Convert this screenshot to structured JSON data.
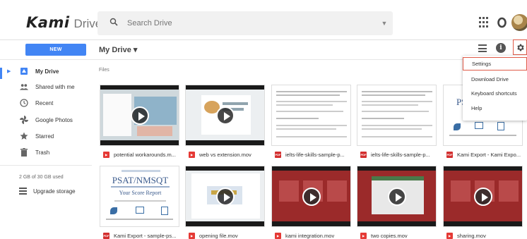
{
  "app": {
    "logo_main": "Kami",
    "logo_sub": "Drive"
  },
  "search": {
    "placeholder": "Search Drive"
  },
  "toolbar": {
    "new_label": "NEW",
    "title": "My Drive ▾"
  },
  "sidebar": {
    "items": [
      {
        "label": "My Drive",
        "icon": "my-drive-icon"
      },
      {
        "label": "Shared with me",
        "icon": "people-icon"
      },
      {
        "label": "Recent",
        "icon": "clock-icon"
      },
      {
        "label": "Google Photos",
        "icon": "pinwheel-icon"
      },
      {
        "label": "Starred",
        "icon": "star-icon"
      },
      {
        "label": "Trash",
        "icon": "trash-icon"
      }
    ],
    "storage": "2 GB of 30 GB used",
    "upgrade": "Upgrade storage"
  },
  "files": {
    "section_label": "Files",
    "items": [
      {
        "name": "potential workarounds.m...",
        "type": "mov"
      },
      {
        "name": "web vs extension.mov",
        "type": "mov"
      },
      {
        "name": "ielts-life-skills-sample-p...",
        "type": "pdf"
      },
      {
        "name": "ielts-life-skills-sample-p...",
        "type": "pdf"
      },
      {
        "name": "Kami Export - Kami Expo...",
        "type": "pdf"
      },
      {
        "name": "Kami Export - sample-ps...",
        "type": "pdf"
      },
      {
        "name": "opening file.mov",
        "type": "mov"
      },
      {
        "name": "kami integration.mov",
        "type": "mov"
      },
      {
        "name": "two copies.mov",
        "type": "mov"
      },
      {
        "name": "sharing.mov",
        "type": "mov"
      }
    ],
    "thumb_texts": {
      "psat_title": "PSAT/NMSQT",
      "psat_sub": "Your Score Report",
      "psat_short": "PS"
    }
  },
  "menu": {
    "items": [
      "Settings",
      "Download Drive",
      "Keyboard shortcuts",
      "Help"
    ],
    "selected_index": 0
  },
  "colors": {
    "accent": "#4285f4",
    "highlight": "#e05a48",
    "video_red": "#9b2a2a"
  }
}
